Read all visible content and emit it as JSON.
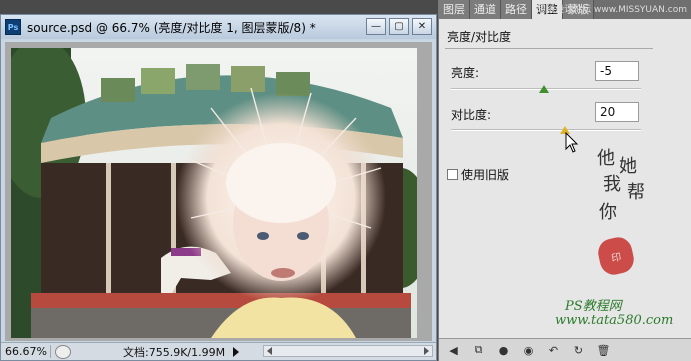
{
  "document": {
    "title": "source.psd @ 66.7% (亮度/对比度 1, 图层蒙版/8) *",
    "app_badge": "Ps",
    "window_buttons": [
      "minimize",
      "restore",
      "close"
    ],
    "status": {
      "zoom": "66.67%",
      "doc_size": "文档:755.9K/1.99M"
    }
  },
  "panel": {
    "tabs": [
      {
        "label": "图层",
        "active": false
      },
      {
        "label": "通道",
        "active": false
      },
      {
        "label": "路径",
        "active": false
      },
      {
        "label": "调整",
        "active": true
      },
      {
        "label": "蒙版",
        "active": false
      }
    ],
    "header_watermark": "思缘设计论坛 www.MISSYUAN.com",
    "adjustment_title": "亮度/对比度",
    "brightness": {
      "label": "亮度:",
      "value": "-5"
    },
    "contrast": {
      "label": "对比度:",
      "value": "20"
    },
    "legacy": {
      "label": "使用旧版",
      "checked": false
    },
    "calligraphy": [
      "他",
      "她",
      "我",
      "帮",
      "你"
    ],
    "seal_text": "印",
    "site_name": "PS教程网",
    "site_url": "www.tata580.com",
    "bottom_icons": [
      "back-icon",
      "clip-icon",
      "mask-icon",
      "eye-icon",
      "prev-state-icon",
      "reset-icon",
      "trash-icon"
    ]
  },
  "colors": {
    "title_bar": "#c8d5e3",
    "panel_bg": "#e6e6e6",
    "brightness_thumb": "#3f8f2f",
    "contrast_thumb": "#e0b22a"
  }
}
